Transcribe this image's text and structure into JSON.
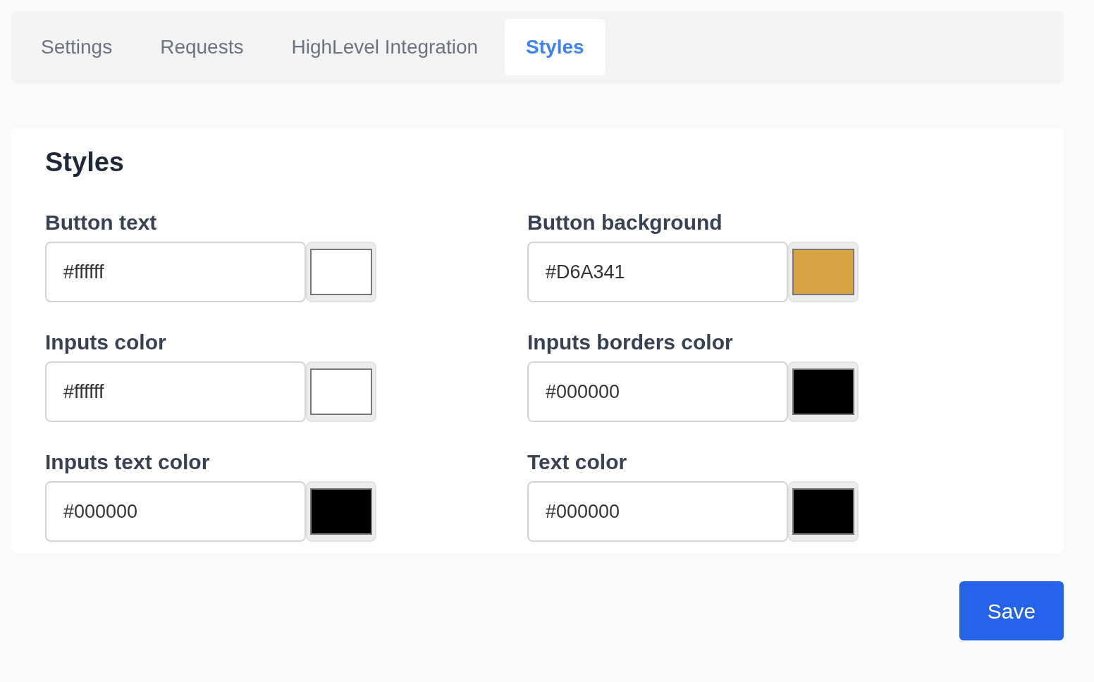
{
  "tabs": [
    {
      "label": "Settings",
      "selected": false
    },
    {
      "label": "Requests",
      "selected": false
    },
    {
      "label": "HighLevel Integration",
      "selected": false
    },
    {
      "label": "Styles",
      "selected": true
    }
  ],
  "panel": {
    "title": "Styles",
    "fields": [
      {
        "label": "Button text",
        "value": "#ffffff",
        "color": "#ffffff"
      },
      {
        "label": "Button background",
        "value": "#D6A341",
        "color": "#d6a341"
      },
      {
        "label": "Inputs color",
        "value": "#ffffff",
        "color": "#ffffff"
      },
      {
        "label": "Inputs borders color",
        "value": "#000000",
        "color": "#000000"
      },
      {
        "label": "Inputs text color",
        "value": "#000000",
        "color": "#000000"
      },
      {
        "label": "Text color",
        "value": "#000000",
        "color": "#000000"
      }
    ]
  },
  "save_button": "Save"
}
